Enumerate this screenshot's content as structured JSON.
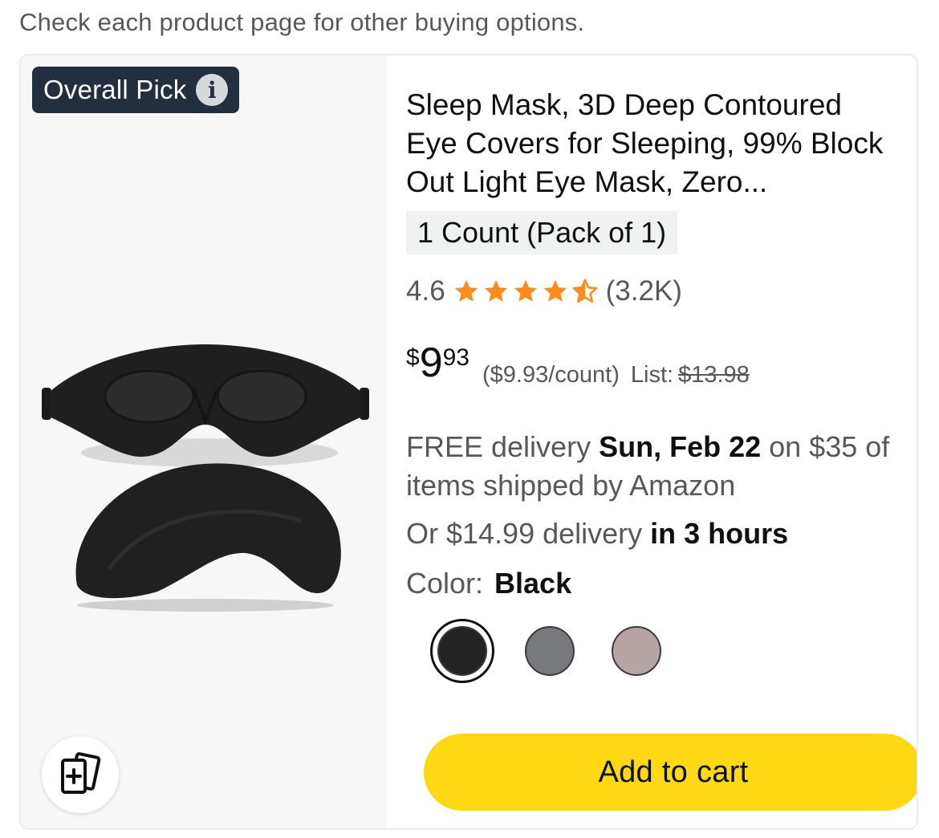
{
  "notice": "Check each product page for other buying options.",
  "badge": {
    "label": "Overall Pick",
    "info_icon": "i"
  },
  "product": {
    "title": "Sleep Mask, 3D Deep Contoured Eye Covers for Sleeping, 99% Block Out Light Eye Mask, Zero...",
    "variant": "1 Count (Pack of 1)",
    "rating": {
      "value": "4.6",
      "stars": 4.5,
      "count": "(3.2K)"
    },
    "price": {
      "symbol": "$",
      "whole": "9",
      "fraction": "93",
      "unit_price": "($9.93/count)",
      "list_label": "List:",
      "list_price": "$13.98"
    },
    "delivery": {
      "prefix": "FREE delivery ",
      "date": "Sun, Feb 22",
      "suffix": " on $35 of items shipped by Amazon",
      "fast_prefix": "Or $14.99 delivery ",
      "fast_time": "in 3 hours"
    },
    "color": {
      "label": "Color:",
      "value": "Black",
      "swatches": [
        {
          "name": "Black",
          "hex": "#232323",
          "selected": true
        },
        {
          "name": "Grey",
          "hex": "#76787c",
          "selected": false
        },
        {
          "name": "Pink",
          "hex": "#b7a5a5",
          "selected": false
        }
      ]
    }
  },
  "actions": {
    "add_to_cart": "Add to cart"
  },
  "colors": {
    "accent": "#ffd814",
    "badge_bg": "#232f3e",
    "star": "#ff8c1a"
  }
}
